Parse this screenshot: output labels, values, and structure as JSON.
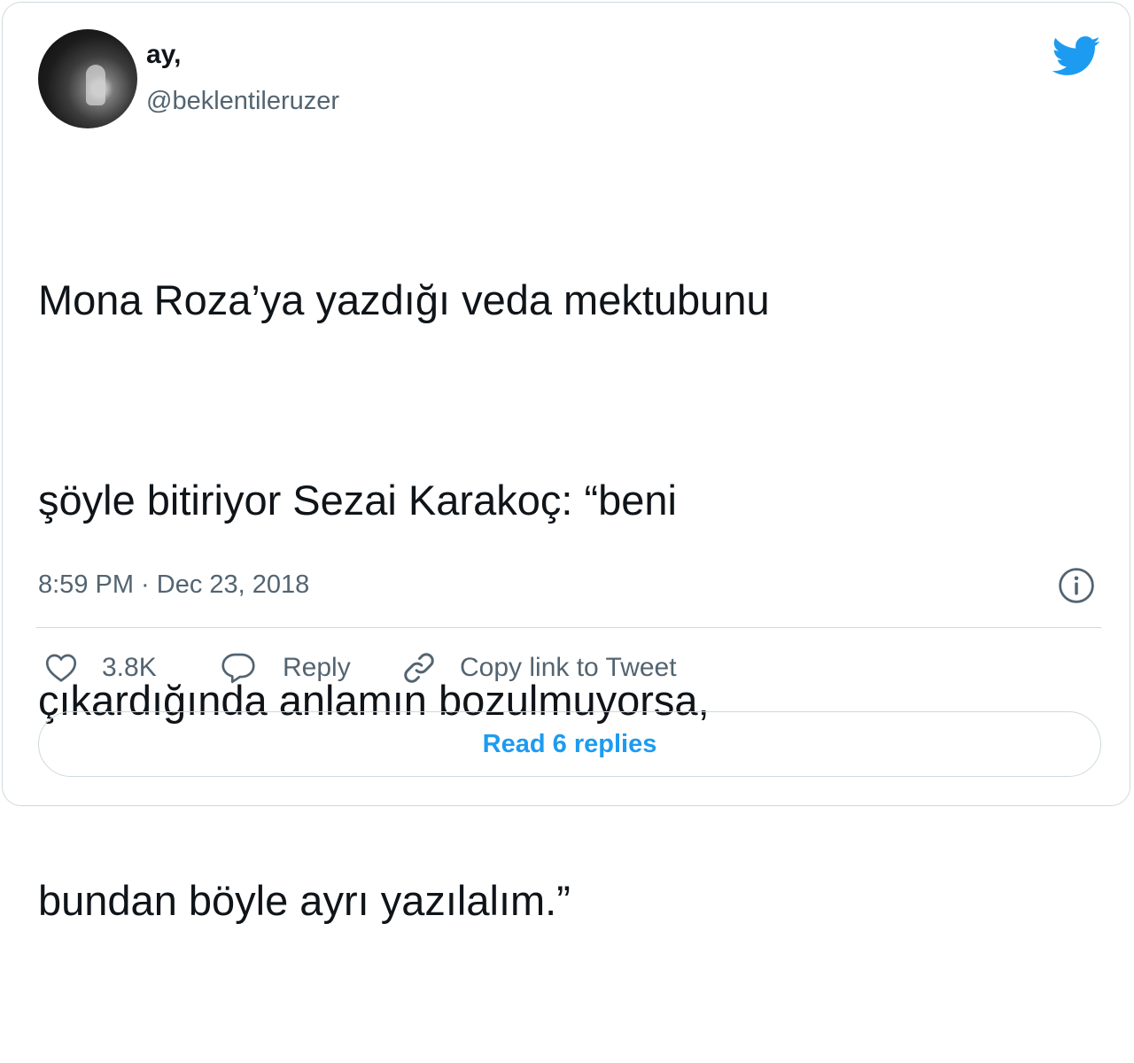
{
  "author": {
    "display_name": "ay,",
    "handle": "@beklentileruzer",
    "avatar_icon": "profile-photo"
  },
  "brand": {
    "icon": "twitter-bird-icon",
    "color": "#1d9bf0"
  },
  "tweet": {
    "lines": [
      "Mona Roza’ya yazdığı veda mektubunu",
      "şöyle bitiriyor Sezai Karakoç: “beni",
      "çıkardığında anlamın bozulmuyorsa,",
      "bundan böyle ayrı yazılalım.”"
    ],
    "timestamp": "8:59 PM · Dec 23, 2018"
  },
  "actions": {
    "like": {
      "icon": "heart-icon",
      "label": "3.8K"
    },
    "reply": {
      "icon": "speech-bubble-icon",
      "label": "Reply"
    },
    "copy_link": {
      "icon": "link-icon",
      "label": "Copy link to Tweet"
    }
  },
  "read_replies": {
    "label": "Read 6 replies"
  },
  "colors": {
    "text_primary": "#0f1419",
    "text_secondary": "#536471",
    "border": "#cfd9de",
    "accent": "#1d9bf0"
  }
}
